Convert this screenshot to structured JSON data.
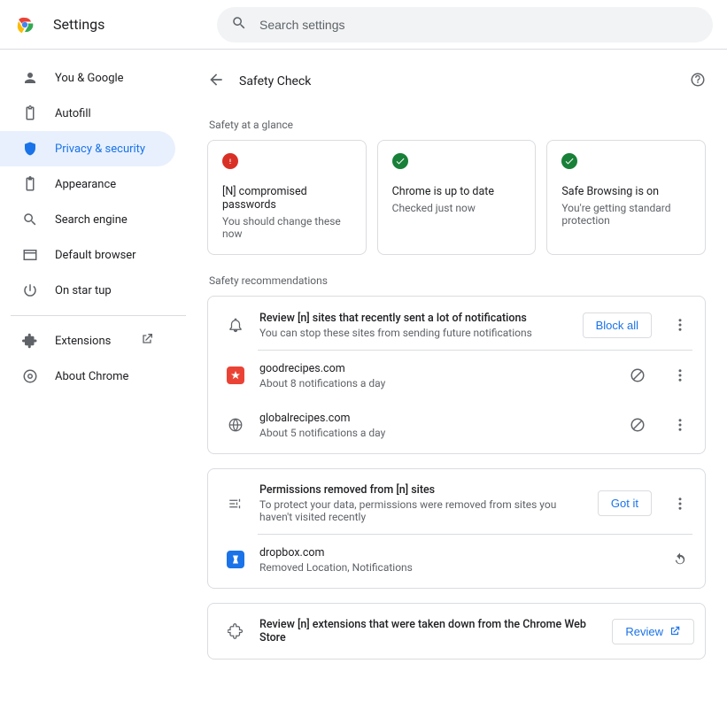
{
  "app_title": "Settings",
  "search": {
    "placeholder": "Search settings"
  },
  "sidebar": {
    "items": [
      {
        "label": "You & Google"
      },
      {
        "label": "Autofill"
      },
      {
        "label": "Privacy & security"
      },
      {
        "label": "Appearance"
      },
      {
        "label": "Search engine"
      },
      {
        "label": "Default browser"
      },
      {
        "label": "On star  tup"
      }
    ],
    "extensions_label": "Extensions",
    "about_label": "About Chrome"
  },
  "page": {
    "title": "Safety Check",
    "glance_heading": "Safety at a glance",
    "recs_heading": "Safety recommendations"
  },
  "glance": [
    {
      "title": "[N] compromised passwords",
      "desc": "You should change these now"
    },
    {
      "title": "Chrome is up to date",
      "desc": "Checked just now"
    },
    {
      "title": "Safe Browsing is on",
      "desc": "You're getting standard protection"
    }
  ],
  "rec_notifications": {
    "title": "Review [n] sites that recently sent a lot of notifications",
    "desc": "You can stop these sites from sending future notifications",
    "action": "Block all",
    "sites": [
      {
        "domain": "goodrecipes.com",
        "desc": "About 8 notifications a day"
      },
      {
        "domain": "globalrecipes.com",
        "desc": "About 5 notifications a day"
      }
    ]
  },
  "rec_permissions": {
    "title": "Permissions removed from [n] sites",
    "desc": "To protect your data, permissions were removed from sites you haven't visited recently",
    "action": "Got it",
    "sites": [
      {
        "domain": "dropbox.com",
        "desc": "Removed Location, Notifications"
      }
    ]
  },
  "rec_extensions": {
    "title": "Review [n] extensions that were taken down from the Chrome Web Store",
    "action": "Review"
  }
}
